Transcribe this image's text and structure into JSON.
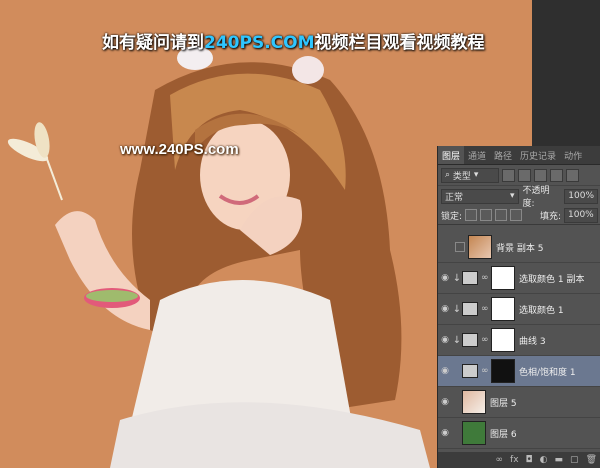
{
  "banner": {
    "prefix": "如有疑问请到",
    "brand": "240PS.COM",
    "suffix": "视频栏目观看视频教程"
  },
  "watermark": "www.240PS.com",
  "panel": {
    "tabs": [
      "图层",
      "通道",
      "路径",
      "历史记录",
      "动作"
    ],
    "filter_kind": "类型",
    "blend_mode": "正常",
    "opacity_label": "不透明度:",
    "opacity_value": "100%",
    "lock_label": "锁定:",
    "fill_label": "填充:",
    "fill_value": "100%",
    "layers": [
      {
        "name": "背景 副本 5",
        "visible": false
      },
      {
        "name": "选取颜色 1 副本",
        "visible": true
      },
      {
        "name": "选取颜色 1",
        "visible": true
      },
      {
        "name": "曲线 3",
        "visible": true
      },
      {
        "name": "色相/饱和度 1",
        "visible": true
      },
      {
        "name": "图层 5",
        "visible": true
      },
      {
        "name": "图层 6",
        "visible": true
      }
    ],
    "footer_icons": [
      "link-icon",
      "fx-icon",
      "mask-icon",
      "adjustment-icon",
      "folder-icon",
      "new-layer-icon",
      "trash-icon"
    ]
  },
  "colors": {
    "background": "#d18c5c",
    "brand": "#2fc6ff",
    "panel": "#535353",
    "selected_layer": "#6b7890"
  }
}
